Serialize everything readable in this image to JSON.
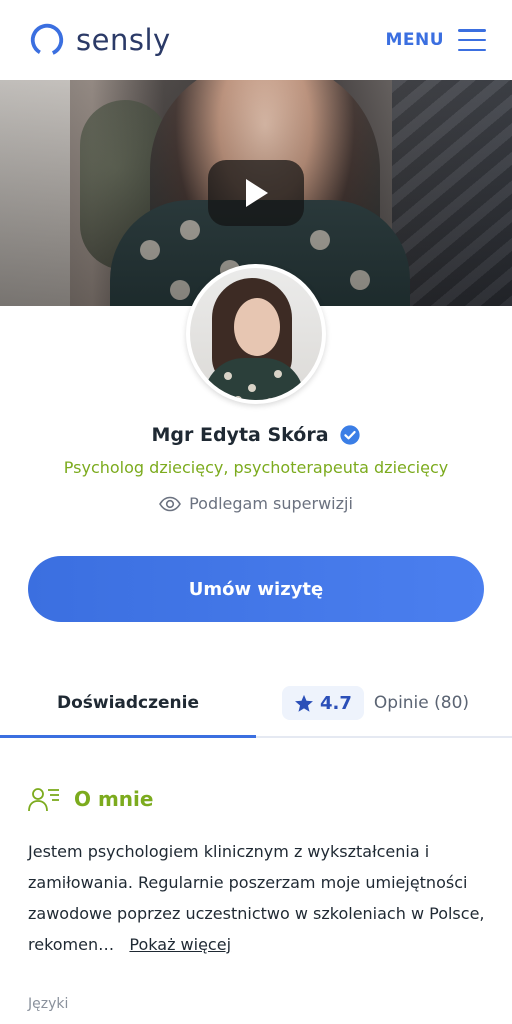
{
  "header": {
    "logo_text": "sensly",
    "menu_label": "MENU"
  },
  "profile": {
    "name": "Mgr Edyta Skóra",
    "specialty": "Psycholog dziecięcy, psychoterapeuta dziecięcy",
    "supervision": "Podlegam superwizji"
  },
  "cta": {
    "label": "Umów wizytę"
  },
  "tabs": {
    "experience": "Doświadczenie",
    "rating": "4.7",
    "reviews": "Opinie (80)"
  },
  "about": {
    "title": "O mnie",
    "text": "Jestem psychologiem klinicznym z wykształcenia i zamiłowania. Regularnie poszerzam moje umiejętności zawodowe poprzez uczestnictwo w szkoleniach w Polsce, rekomen…",
    "show_more": "Pokaż więcej"
  },
  "languages_label": "Języki",
  "icons": {
    "logo": "sensly-logo-icon",
    "menu": "hamburger-icon",
    "play": "play-icon",
    "verified": "verified-check-icon",
    "supervision": "eye-icon",
    "rating": "star-icon",
    "about": "person-list-icon"
  },
  "colors": {
    "accent": "#3b6fe0",
    "green": "#7cab1e",
    "brand_dark": "#2b3a67"
  }
}
